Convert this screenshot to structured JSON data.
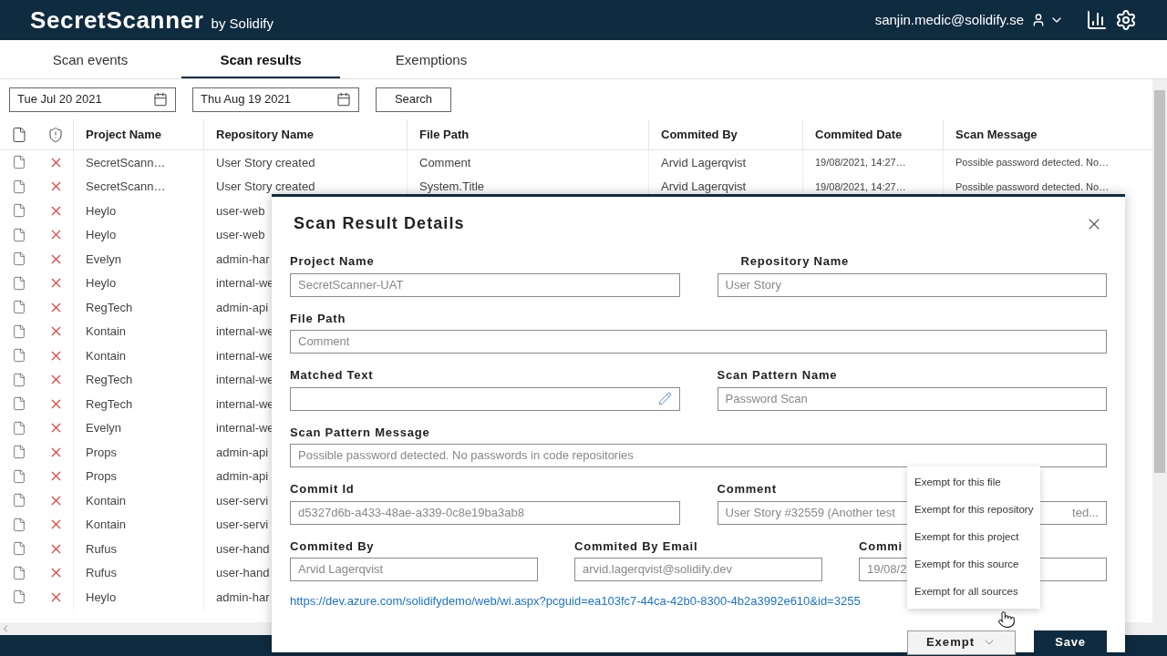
{
  "header": {
    "brand": "SecretScanner",
    "brand_suffix": "by Solidify",
    "user": "sanjin.medic@solidify.se"
  },
  "tabs": [
    {
      "label": "Scan events",
      "selected": false
    },
    {
      "label": "Scan results",
      "selected": true
    },
    {
      "label": "Exemptions",
      "selected": false
    }
  ],
  "filters": {
    "from_date": "Tue Jul 20 2021",
    "to_date": "Thu Aug 19 2021",
    "search_button": "Search"
  },
  "table": {
    "columns": [
      "Project Name",
      "Repository Name",
      "File Path",
      "Commited By",
      "Commited Date",
      "Scan Message"
    ],
    "rows": [
      {
        "cells": [
          "SecretScann…",
          "User Story created",
          "Comment",
          "Arvid Lagerqvist",
          "19/08/2021, 14:27…",
          "Possible password detected. No…"
        ]
      },
      {
        "cells": [
          "SecretScann…",
          "User Story created",
          "System.Title",
          "Arvid Lagerqvist",
          "19/08/2021, 14:27…",
          "Possible password detected. No…"
        ]
      },
      {
        "cells": [
          "Heylo",
          "user-web"
        ]
      },
      {
        "cells": [
          "Heylo",
          "user-web"
        ]
      },
      {
        "cells": [
          "Evelyn",
          "admin-har"
        ]
      },
      {
        "cells": [
          "Heylo",
          "internal-we"
        ]
      },
      {
        "cells": [
          "RegTech",
          "admin-api"
        ]
      },
      {
        "cells": [
          "Kontain",
          "internal-we"
        ]
      },
      {
        "cells": [
          "Kontain",
          "internal-we"
        ]
      },
      {
        "cells": [
          "RegTech",
          "internal-we"
        ]
      },
      {
        "cells": [
          "RegTech",
          "internal-we"
        ]
      },
      {
        "cells": [
          "Evelyn",
          "internal-we"
        ]
      },
      {
        "cells": [
          "Props",
          "admin-api"
        ]
      },
      {
        "cells": [
          "Props",
          "admin-api"
        ]
      },
      {
        "cells": [
          "Kontain",
          "user-servi"
        ]
      },
      {
        "cells": [
          "Kontain",
          "user-servi"
        ]
      },
      {
        "cells": [
          "Rufus",
          "user-hand"
        ]
      },
      {
        "cells": [
          "Rufus",
          "user-hand"
        ]
      },
      {
        "cells": [
          "Heylo",
          "admin-har"
        ]
      }
    ]
  },
  "modal": {
    "title": "Scan Result Details",
    "project_name": {
      "label": "Project Name",
      "value": "SecretScanner-UAT"
    },
    "repository_name": {
      "label": "Repository Name",
      "value": "User Story"
    },
    "file_path": {
      "label": "File Path",
      "value": "Comment"
    },
    "matched_text": {
      "label": "Matched Text"
    },
    "scan_pattern_name": {
      "label": "Scan Pattern Name",
      "value": "Password Scan"
    },
    "scan_pattern_message": {
      "label": "Scan Pattern Message",
      "value": "Possible password detected. No passwords in code repositories"
    },
    "commit_id": {
      "label": "Commit Id",
      "value": "d5327d6b-a433-48ae-a339-0c8e19ba3ab8"
    },
    "comment": {
      "label": "Comment",
      "value": "User Story #32559 (Another test",
      "value_tail": "ted..."
    },
    "commited_by": {
      "label": "Commited By",
      "value": "Arvid Lagerqvist"
    },
    "commited_by_email": {
      "label": "Commited By Email",
      "value": "arvid.lagerqvist@solidify.dev"
    },
    "commited_date": {
      "label": "Commi",
      "value": "19/08/2"
    },
    "link": "https://dev.azure.com/solidifydemo/web/wi.aspx?pcguid=ea103fc7-44ca-42b0-8300-4b2a3992e610&id=3255",
    "exempt_button": "Exempt",
    "save_button": "Save",
    "exempt_menu": [
      "Exempt for this file",
      "Exempt for this repository",
      "Exempt for this project",
      "Exempt for this source",
      "Exempt for all sources"
    ]
  }
}
